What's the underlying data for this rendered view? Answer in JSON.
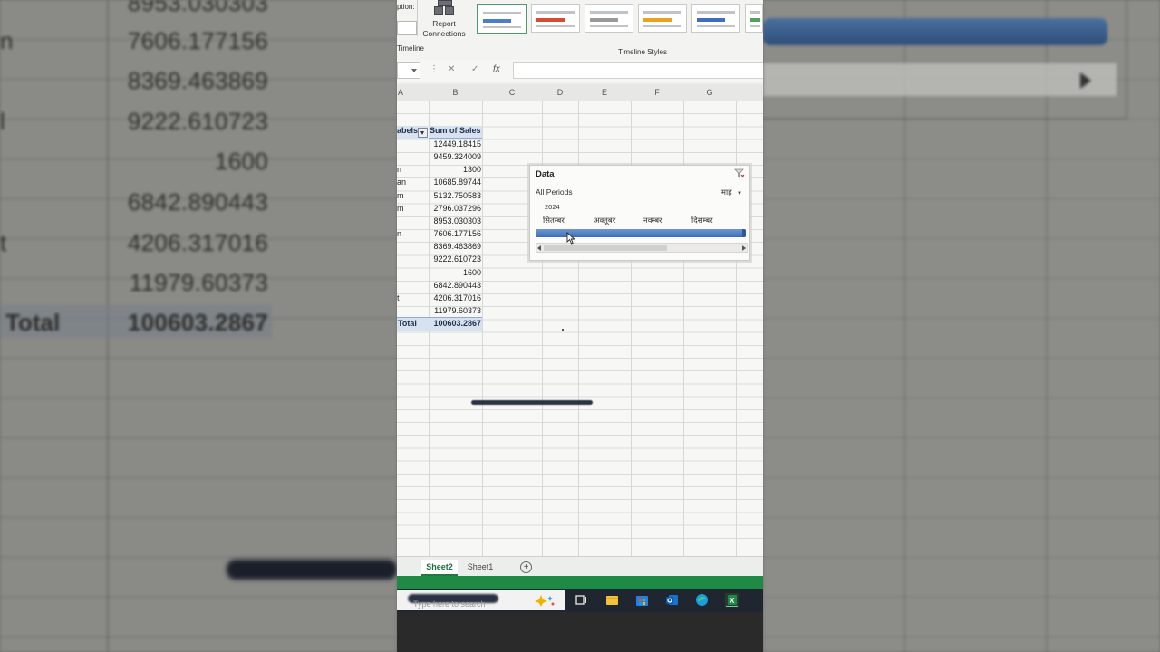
{
  "ribbon": {
    "option_caption": "ption:",
    "timeline_caption": "Timeline",
    "report_connections": "Report Connections",
    "timeline_styles": "Timeline Styles"
  },
  "formula": {
    "cancel": "✕",
    "enter": "✓",
    "fx": "fx"
  },
  "columns": [
    "A",
    "B",
    "C",
    "D",
    "E",
    "F",
    "G"
  ],
  "pivot": {
    "row_labels_header": "abels",
    "sum_header": "Sum of Sales",
    "row_label_fragments": [
      "",
      "",
      "n",
      "an",
      "m",
      "m",
      "",
      "n",
      "",
      "",
      "",
      "",
      "t",
      ""
    ],
    "values": [
      "12449.18415",
      "9459.324009",
      "1300",
      "10685.89744",
      "5132.750583",
      "2796.037296",
      "8953.030303",
      "7606.177156",
      "8369.463869",
      "9222.610723",
      "1600",
      "6842.890443",
      "4206.317016",
      "11979.60373"
    ],
    "total_label": "Total",
    "total_value": "100603.2867"
  },
  "timeline": {
    "title": "Data",
    "all_periods": "All Periods",
    "level": "माह",
    "year": "2024",
    "months": [
      "सितम्बर",
      "अक्तूबर",
      "नवम्बर",
      "दिसम्बर"
    ],
    "selection_fraction": 1.0
  },
  "tabs": {
    "sheet2": "Sheet2",
    "sheet1": "Sheet1",
    "add": "+"
  },
  "taskbar": {
    "search_placeholder": "Type here to search"
  },
  "background": {
    "left_values": [
      "8953.030303",
      "7606.177156",
      "8369.463869",
      "9222.610723",
      "1600",
      "6842.890443",
      "4206.317016",
      "11979.60373"
    ],
    "left_labels": [
      "",
      "n",
      "",
      "l",
      "",
      "",
      "t",
      ""
    ],
    "total_label": "Total",
    "total_value": "100603.2867"
  },
  "colors": {
    "excel_green": "#1e8a46",
    "pivot_header": "#d7e2f1",
    "timeline_bar": "#4a78bb"
  }
}
